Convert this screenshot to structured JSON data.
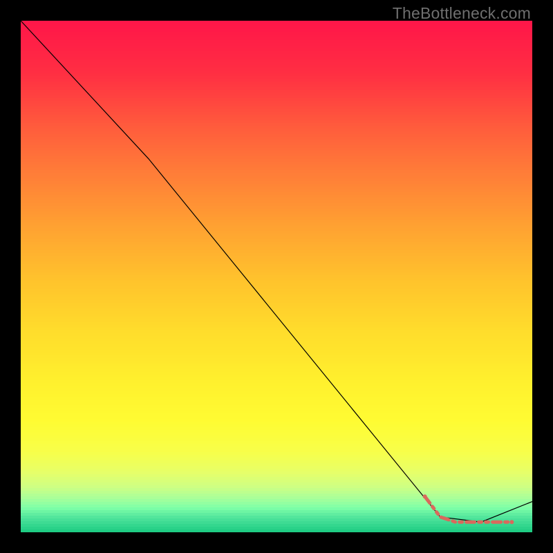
{
  "watermark": "TheBottleneck.com",
  "chart_data": {
    "type": "line",
    "xlim": [
      0,
      100
    ],
    "ylim": [
      0,
      100
    ],
    "grid": false,
    "legend": false,
    "background": {
      "type": "vertical-gradient-banded",
      "stops": [
        {
          "y": 0,
          "color": "#ff1749"
        },
        {
          "y": 10,
          "color": "#ff2f43"
        },
        {
          "y": 20,
          "color": "#ff5a3d"
        },
        {
          "y": 30,
          "color": "#ff7f38"
        },
        {
          "y": 40,
          "color": "#ffa232"
        },
        {
          "y": 50,
          "color": "#ffc22d"
        },
        {
          "y": 60,
          "color": "#ffdc2c"
        },
        {
          "y": 70,
          "color": "#fff02e"
        },
        {
          "y": 78,
          "color": "#fffc33"
        },
        {
          "y": 84,
          "color": "#f8ff4a"
        },
        {
          "y": 88,
          "color": "#e7ff69"
        },
        {
          "y": 91,
          "color": "#cdff85"
        },
        {
          "y": 93,
          "color": "#aaff9a"
        },
        {
          "y": 95,
          "color": "#7effa8"
        },
        {
          "y": 97,
          "color": "#4ee39b"
        },
        {
          "y": 100,
          "color": "#17c97f"
        }
      ]
    },
    "series": [
      {
        "name": "bottleneck-curve",
        "color": "#000000",
        "stroke_width": 1.2,
        "x": [
          0,
          25,
          82,
          90,
          100
        ],
        "values": [
          100,
          73,
          3,
          2,
          6
        ]
      },
      {
        "name": "highlight-segment",
        "color": "#d9695c",
        "stroke_width": 5,
        "dash": "12 6 4 6 4 6",
        "x": [
          79,
          82,
          85,
          88,
          90,
          92,
          94,
          96
        ],
        "values": [
          7,
          3,
          2,
          2,
          2,
          2,
          2,
          2
        ]
      }
    ]
  }
}
